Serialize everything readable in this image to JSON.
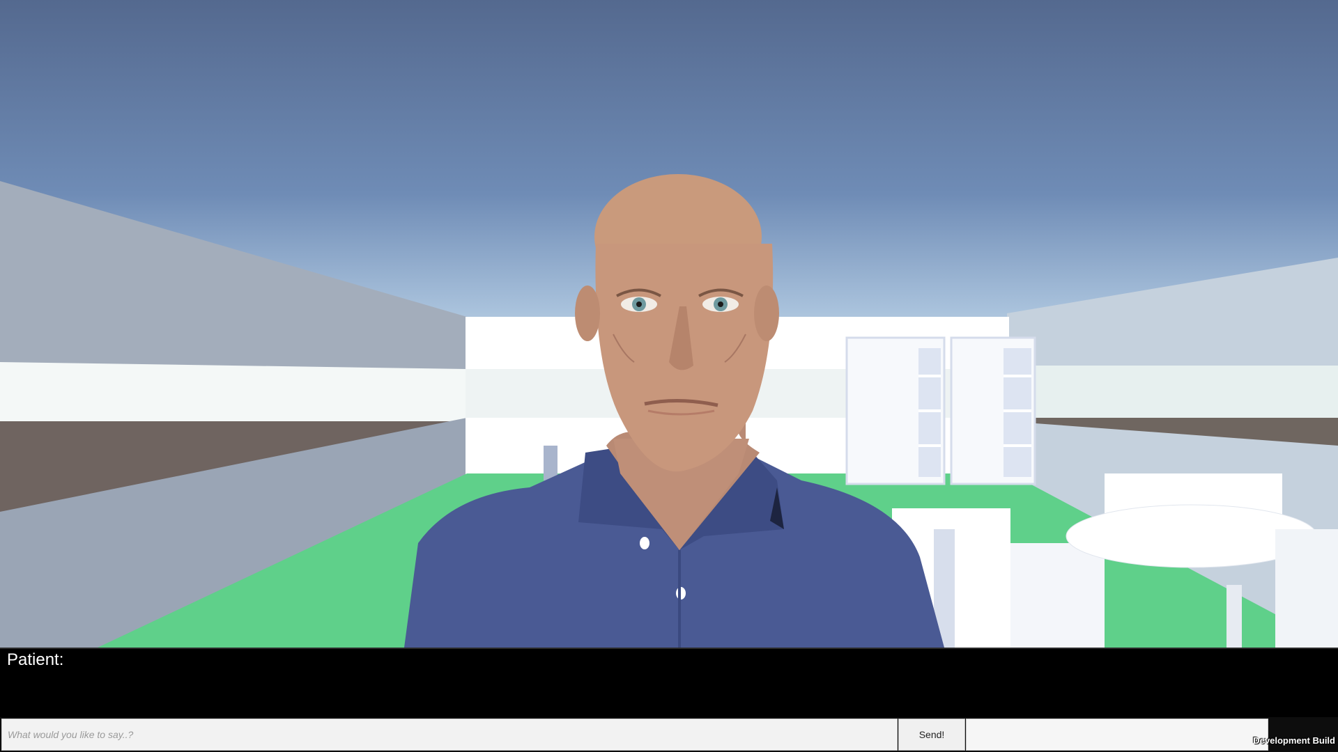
{
  "dialog": {
    "speaker_label": "Patient:",
    "speech_text": ""
  },
  "chat": {
    "input_value": "",
    "input_placeholder": "What would you like to say..?",
    "send_label": "Send!"
  },
  "overlay": {
    "build_label": "Development Build"
  },
  "scene": {
    "sky_color": "#6f8cb6",
    "floor_color": "#5fd08a",
    "shirt_color": "#4a5a94",
    "skin_color": "#c8977c",
    "character": "patient-avatar"
  }
}
